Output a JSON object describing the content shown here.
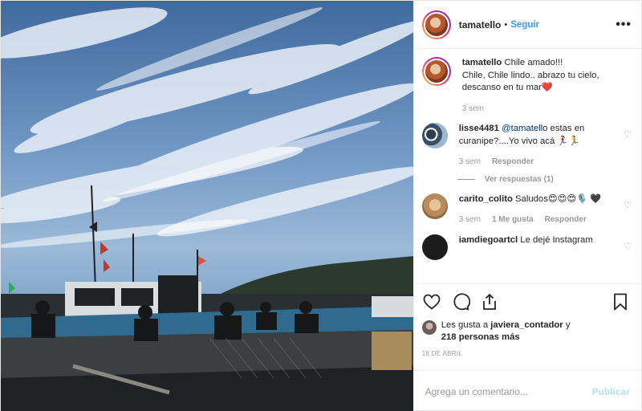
{
  "header": {
    "username": "tamatello",
    "separator": "•",
    "follow_label": "Seguir",
    "more_label": "•••"
  },
  "caption": {
    "username": "tamatello",
    "text_line1": "Chile amado!!!",
    "text_line2": "Chile, Chile lindo.. abrazo tu cielo,",
    "text_line3": "descanso en tu mar❤️",
    "time": "3 sem"
  },
  "comments": [
    {
      "username": "lisse4481",
      "mention": "@tamatello",
      "text": " estas en curanipe?....Yo vivo acá 🏃‍♀️🏃",
      "time": "3 sem",
      "reply_label": "Responder",
      "view_replies": "Ver respuestas (1)"
    },
    {
      "username": "carito_colito",
      "text": " Saludos😍😍😍🎙️ 🖤",
      "time": "3 sem",
      "likes": "1 Me gusta",
      "reply_label": "Responder"
    },
    {
      "username": "iamdiegoartcl",
      "text": " Le dejé Instagram"
    }
  ],
  "likes": {
    "prefix": "Les gusta a ",
    "user": "javiera_contador",
    "suffix": " y",
    "more": "218 personas más"
  },
  "date": "18 DE ABRIL",
  "add_comment": {
    "placeholder": "Agrega un comentario...",
    "publish_label": "Publicar"
  },
  "icons": {
    "like": "heart-icon",
    "comment": "comment-icon",
    "share": "share-icon",
    "save": "bookmark-icon"
  }
}
